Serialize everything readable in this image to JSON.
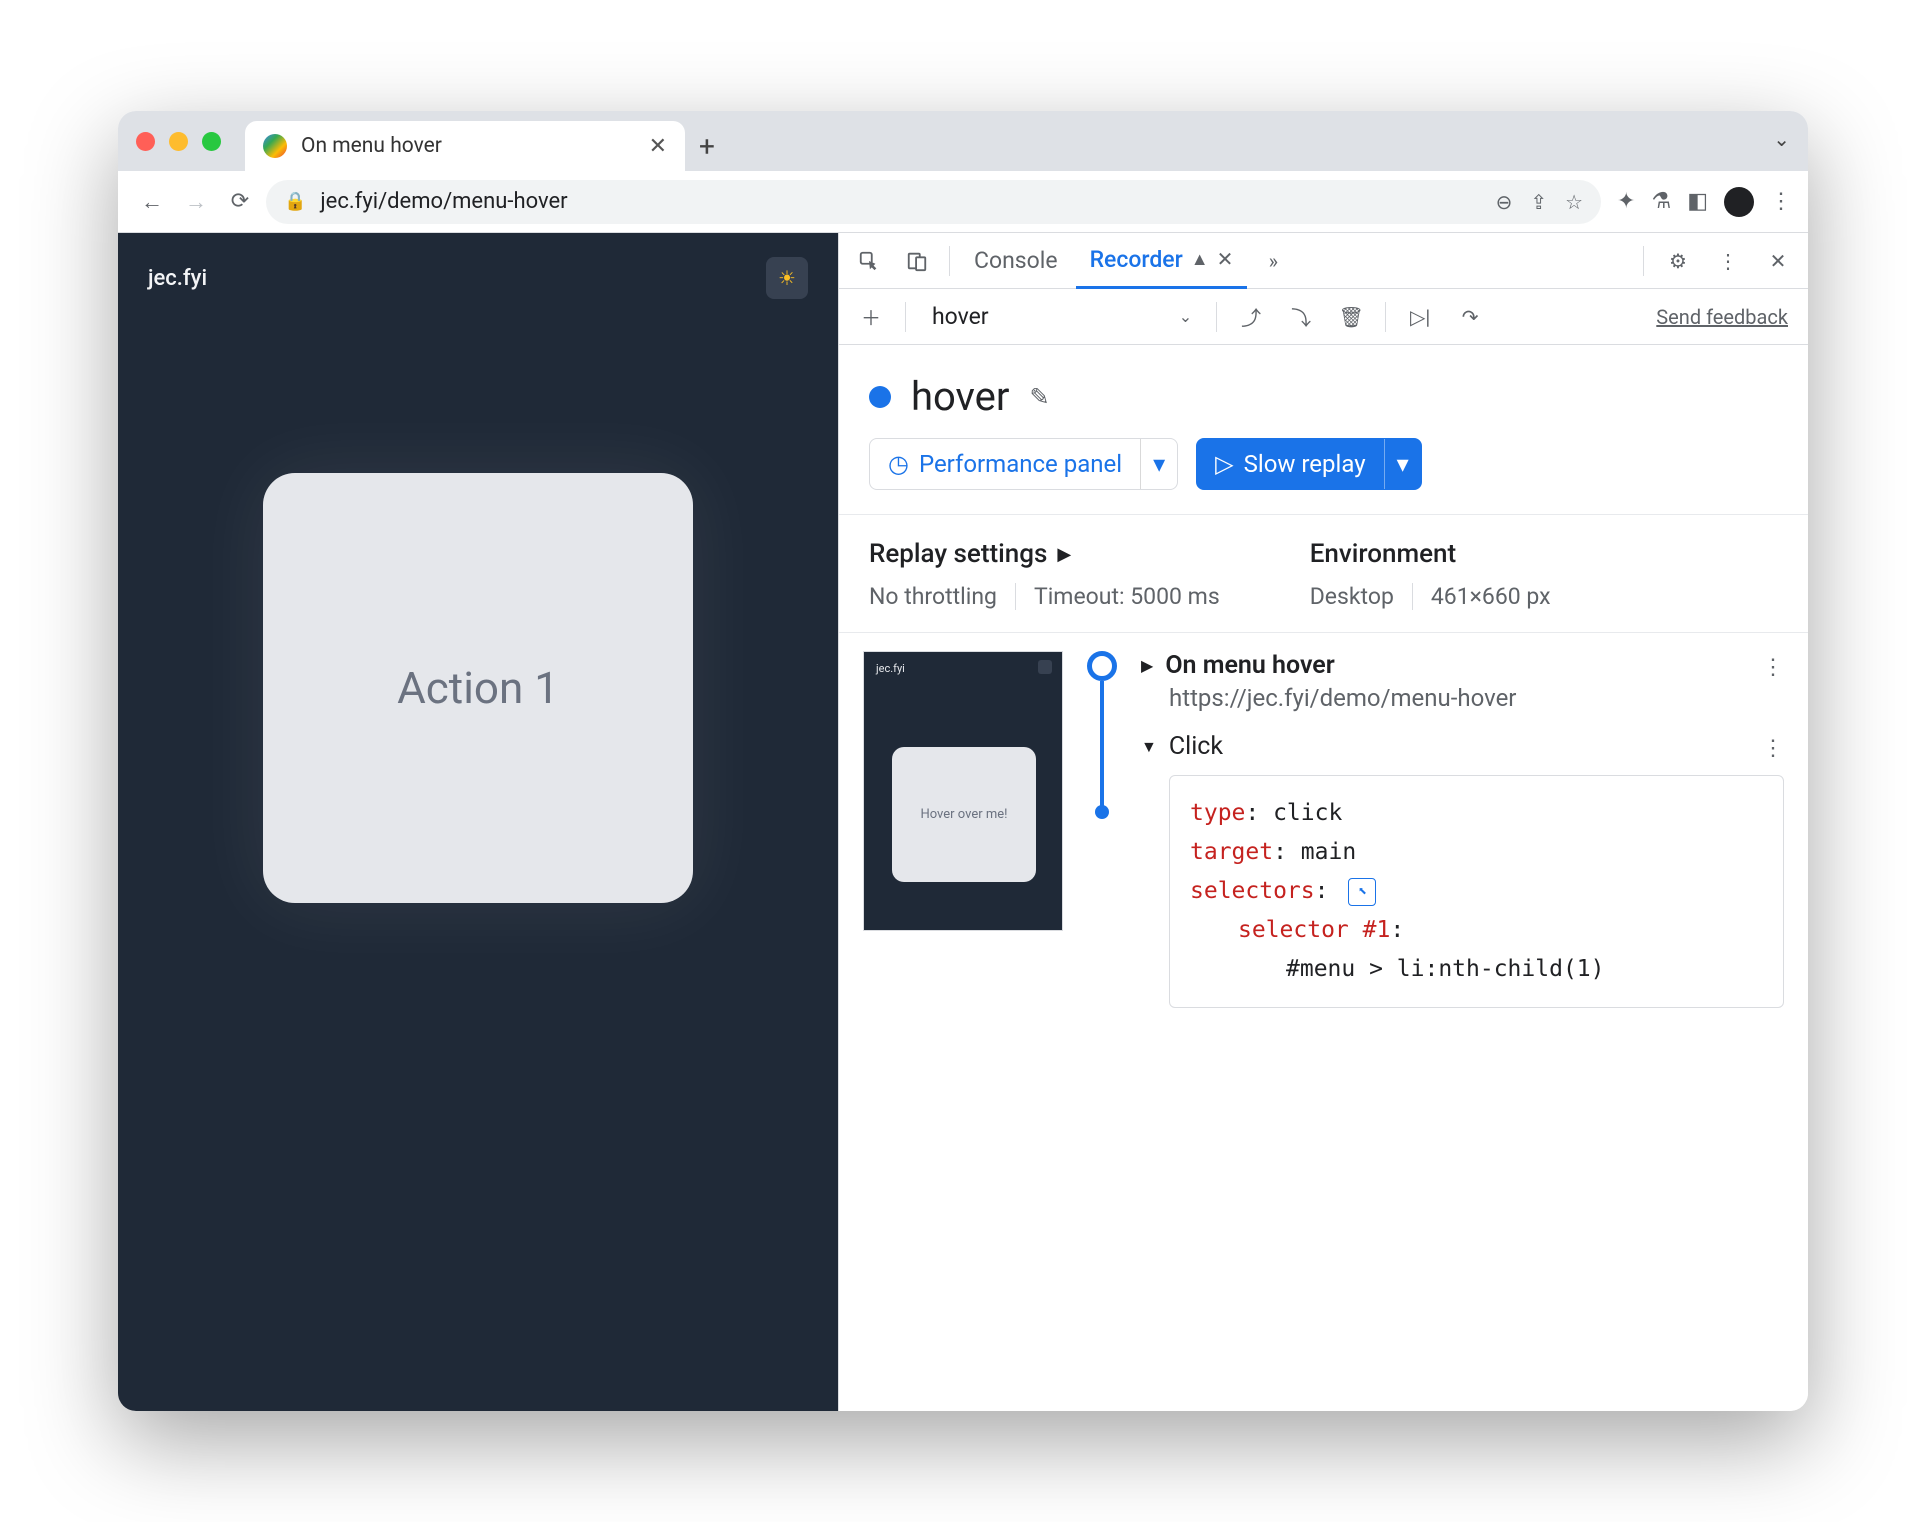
{
  "browser": {
    "tab_title": "On menu hover",
    "url": "jec.fyi/demo/menu-hover"
  },
  "page": {
    "brand": "jec.fyi",
    "card_text": "Action 1"
  },
  "devtools": {
    "tabs": {
      "console": "Console",
      "recorder": "Recorder"
    },
    "recording_dropdown": "hover",
    "feedback": "Send feedback",
    "title": "hover",
    "buttons": {
      "perf": "Performance panel",
      "replay": "Slow replay"
    },
    "settings": {
      "replay_heading": "Replay settings",
      "throttling": "No throttling",
      "timeout": "Timeout: 5000 ms",
      "env_heading": "Environment",
      "env_device": "Desktop",
      "env_dims": "461×660 px"
    },
    "thumb": {
      "brand": "jec.fyi",
      "card": "Hover over me!"
    },
    "step0": {
      "title": "On menu hover",
      "url": "https://jec.fyi/demo/menu-hover"
    },
    "step1": {
      "title": "Click",
      "type_k": "type",
      "type_v": ": click",
      "target_k": "target",
      "target_v": ": main",
      "selectors_k": "selectors",
      "selectors_v": ":",
      "sel1_k": "selector #1",
      "sel1_v": ":",
      "sel_code": "#menu > li:nth-child(1)"
    }
  }
}
